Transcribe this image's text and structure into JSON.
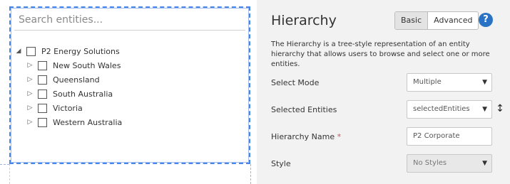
{
  "search": {
    "placeholder": "Search entities..."
  },
  "tree": {
    "root": "P2 Energy Solutions",
    "children": [
      "New South Wales",
      "Queensland",
      "South Australia",
      "Victoria",
      "Western Australia"
    ]
  },
  "panel": {
    "title": "Hierarchy",
    "modes": {
      "basic": "Basic",
      "advanced": "Advanced"
    },
    "help_glyph": "?",
    "description": "The Hierarchy is a tree-style representation of an entity hierarchy that allows users to browse and select one or more entities.",
    "fields": {
      "select_mode": {
        "label": "Select Mode",
        "value": "Multiple"
      },
      "selected_entities": {
        "label": "Selected Entities",
        "value": "selectedEntities"
      },
      "hierarchy_name": {
        "label": "Hierarchy Name",
        "required": "*",
        "value": "P2 Corporate"
      },
      "style": {
        "label": "Style",
        "value": "No Styles"
      }
    }
  },
  "colors": {
    "accent": "#4a86e8",
    "help": "#2a72c4",
    "required": "#d9534f",
    "panel_bg": "#f2f2f2"
  },
  "icons": {
    "expanded": "triangle-down-icon",
    "collapsed": "triangle-right-icon",
    "help": "help-icon",
    "resize": "vertical-resize-icon"
  }
}
